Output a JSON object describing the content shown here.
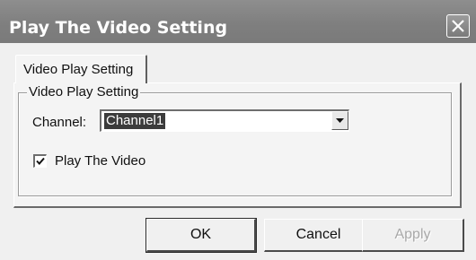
{
  "window": {
    "title": "Play The Video Setting",
    "close_icon": "close-icon"
  },
  "tabs": [
    {
      "label": "Video Play Setting",
      "selected": true
    }
  ],
  "group": {
    "legend": "Video Play Setting",
    "channel_label": "Channel:",
    "channel_value": "Channel1",
    "dropdown_icon": "chevron-down-icon",
    "play_checkbox_label": "Play The Video",
    "play_checked": true
  },
  "buttons": {
    "ok": "OK",
    "cancel": "Cancel",
    "apply": "Apply",
    "apply_enabled": false
  }
}
